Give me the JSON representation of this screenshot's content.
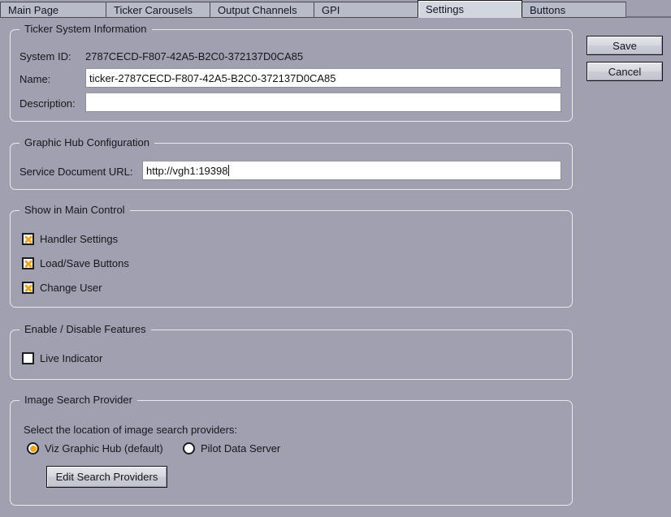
{
  "window": {
    "background_color": "#a0a0b0"
  },
  "tabs": [
    {
      "label": "Main Page",
      "active": false
    },
    {
      "label": "Ticker Carousels",
      "active": false
    },
    {
      "label": "Output Channels",
      "active": false
    },
    {
      "label": "GPI",
      "active": false
    },
    {
      "label": "Settings",
      "active": true
    },
    {
      "label": "Buttons",
      "active": false
    }
  ],
  "actions": {
    "save_label": "Save",
    "cancel_label": "Cancel"
  },
  "ticker_system_information": {
    "legend": "Ticker System Information",
    "system_id_label": "System ID:",
    "system_id_value": "2787CECD-F807-42A5-B2C0-372137D0CA85",
    "name_label": "Name:",
    "name_value": "ticker-2787CECD-F807-42A5-B2C0-372137D0CA85",
    "description_label": "Description:",
    "description_value": ""
  },
  "graphic_hub_configuration": {
    "legend": "Graphic Hub Configuration",
    "service_document_url_label": "Service Document URL:",
    "service_document_url_value": "http://vgh1:19398"
  },
  "show_in_main_control": {
    "legend": "Show in Main Control",
    "items": [
      {
        "label": "Handler Settings",
        "checked": true
      },
      {
        "label": "Load/Save Buttons",
        "checked": true
      },
      {
        "label": "Change User",
        "checked": true
      }
    ]
  },
  "enable_disable_features": {
    "legend": "Enable / Disable Features",
    "items": [
      {
        "label": "Live Indicator",
        "checked": false
      }
    ]
  },
  "image_search_provider": {
    "legend": "Image Search Provider",
    "instruction": "Select the location of image search providers:",
    "options": [
      {
        "label": "Viz Graphic Hub (default)",
        "selected": true
      },
      {
        "label": "Pilot Data Server",
        "selected": false
      }
    ],
    "edit_button_label": "Edit Search Providers"
  },
  "colors": {
    "accent_orange": "#f0a51e",
    "page_background": "#a0a0b0",
    "active_tab": "#d2d6de",
    "inactive_tab": "#b8bcc8"
  }
}
